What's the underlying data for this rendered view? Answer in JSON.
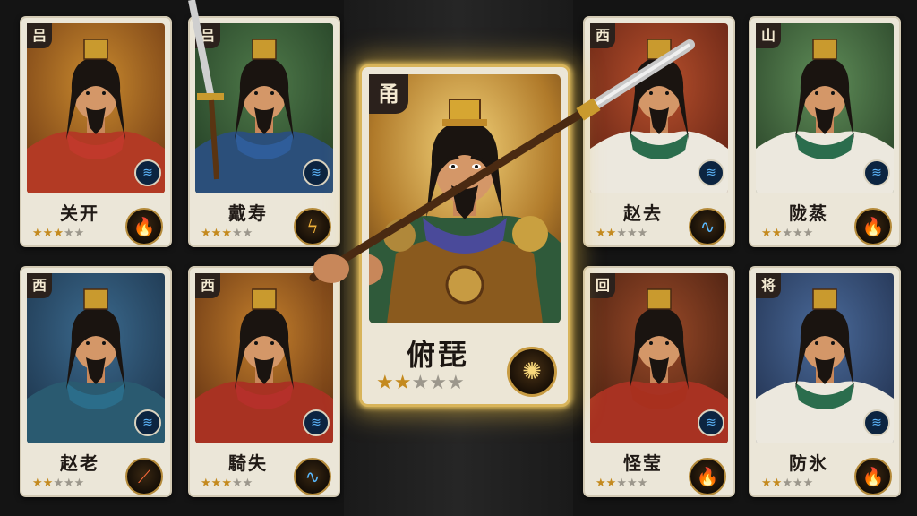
{
  "colors": {
    "accent_gold": "#d8b45a",
    "card_bg": "#ebe6d8",
    "star_on": "#c48a1f",
    "star_off": "#9c978c"
  },
  "cards_top_left": [
    {
      "faction": "吕",
      "name": "关开",
      "stars_filled": 3,
      "stars_total": 5,
      "element_icon": "wind-swirl-icon",
      "skill_icon": "flame-burst-icon",
      "bg": [
        "#c98a2e",
        "#6a3412"
      ],
      "armor": "#b23a24",
      "scarf": "#c0392b"
    },
    {
      "faction": "吕",
      "name": "戴寿",
      "stars_filled": 3,
      "stars_total": 5,
      "element_icon": "wind-swirl-icon",
      "skill_icon": "flame-slash-icon",
      "bg": [
        "#4f7a4a",
        "#203a22"
      ],
      "armor": "#2b4f7a",
      "scarf": "#2f5d9a"
    }
  ],
  "cards_top_right": [
    {
      "faction": "西",
      "name": "赵去",
      "stars_filled": 2,
      "stars_total": 5,
      "element_icon": "wind-swirl-icon",
      "skill_icon": "water-wave-icon",
      "bg": [
        "#b8502c",
        "#5a1e12"
      ],
      "armor": "#ece8de",
      "scarf": "#2b6d4d"
    },
    {
      "faction": "山",
      "name": "陇蒸",
      "stars_filled": 2,
      "stars_total": 5,
      "element_icon": "wind-swirl-icon",
      "skill_icon": "flame-burst-icon",
      "bg": [
        "#5f8d58",
        "#253d24"
      ],
      "armor": "#ece8de",
      "scarf": "#2b6d4d"
    }
  ],
  "cards_bottom_left": [
    {
      "faction": "西",
      "name": "赵老",
      "stars_filled": 2,
      "stars_total": 5,
      "element_icon": "wind-swirl-icon",
      "skill_icon": "fire-slash-icon",
      "bg": [
        "#3b6a8e",
        "#1a2f45"
      ],
      "armor": "#2a5a70",
      "scarf": "#2b6d8a"
    },
    {
      "faction": "西",
      "name": "騎失",
      "stars_filled": 3,
      "stars_total": 5,
      "element_icon": "wind-swirl-icon",
      "skill_icon": "water-wave-icon",
      "bg": [
        "#c4802c",
        "#5a2a10"
      ],
      "armor": "#a83222",
      "scarf": "#b5302a"
    }
  ],
  "cards_bottom_right": [
    {
      "faction": "回",
      "name": "怪莹",
      "stars_filled": 2,
      "stars_total": 5,
      "element_icon": "wind-swirl-icon",
      "skill_icon": "flame-burst-icon",
      "bg": [
        "#9a4a28",
        "#3e1a0e"
      ],
      "armor": "#a83222",
      "scarf": "#a8301e"
    },
    {
      "faction": "将",
      "name": "防氷",
      "stars_filled": 2,
      "stars_total": 5,
      "element_icon": "wind-swirl-icon",
      "skill_icon": "flame-burst-icon",
      "bg": [
        "#4a6a9a",
        "#1e2c48"
      ],
      "armor": "#ece8de",
      "scarf": "#2b6d4d"
    }
  ],
  "featured": {
    "faction": "甬",
    "name": "俯琵",
    "stars_filled": 2,
    "stars_total": 5,
    "skill_icon": "radiant-burst-icon"
  }
}
